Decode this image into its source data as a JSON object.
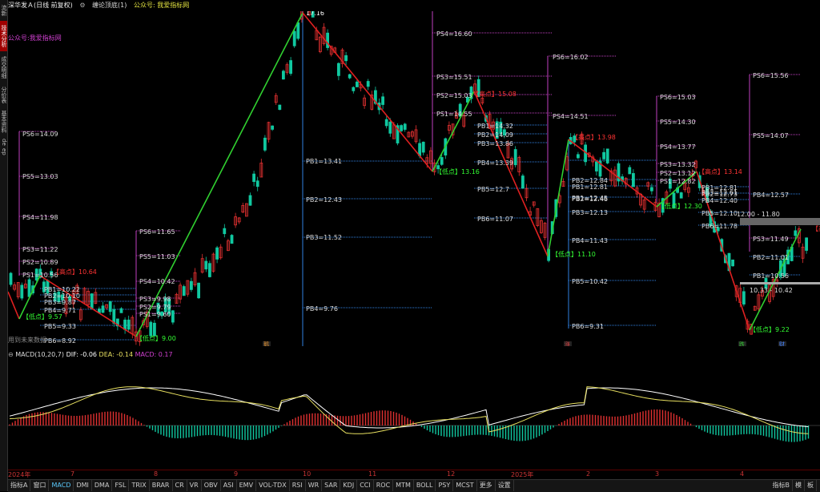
{
  "header": {
    "stock": "深华发Ａ(日线 前复权)",
    "indicator": "缠论顶底(1)",
    "watermark_note": "公众号: 我爱指标网"
  },
  "chart_note": "公众号:我爱指标网",
  "future_note": "用到未来数据",
  "left_rail": [
    "流新",
    "技术分析",
    "成交明细",
    "分价表",
    "基本资料",
    "de",
    "ep"
  ],
  "main_labels": [
    {
      "text": "17.16",
      "color": "#fff"
    },
    {
      "text": "PS4=16.60",
      "color": "#ddd"
    },
    {
      "text": "PS6=16.02",
      "color": "#ddd"
    },
    {
      "text": "PS3=15.51",
      "color": "#ddd"
    },
    {
      "text": "PS2=15.03",
      "color": "#ddd"
    },
    {
      "text": "【高点】15.08",
      "color": "#f33"
    },
    {
      "text": "PS1=14.55",
      "color": "#ddd"
    },
    {
      "text": "PS4=14.51",
      "color": "#ddd"
    },
    {
      "text": "PB1=14.32",
      "color": "#ddd"
    },
    {
      "text": "PB2=14.09",
      "color": "#ddd"
    },
    {
      "text": "PB3=13.86",
      "color": "#ddd"
    },
    {
      "text": "【高点】13.98",
      "color": "#f33"
    },
    {
      "text": "PB1=13.41",
      "color": "#ddd"
    },
    {
      "text": "PB4=13.39",
      "color": "#ddd"
    },
    {
      "text": "【低点】13.16",
      "color": "#3f3"
    },
    {
      "text": "PS6=15.03",
      "color": "#ddd"
    },
    {
      "text": "PS5=14.30",
      "color": "#ddd"
    },
    {
      "text": "PS4=13.77",
      "color": "#ddd"
    },
    {
      "text": "PS3=13.32",
      "color": "#ddd"
    },
    {
      "text": "PS2=13.12",
      "color": "#ddd"
    },
    {
      "text": "【高点】13.14",
      "color": "#f33"
    },
    {
      "text": "PS1=12.82",
      "color": "#ddd"
    },
    {
      "text": "PB2=12.43",
      "color": "#ddd"
    },
    {
      "text": "PB5=12.7",
      "color": "#ddd"
    },
    {
      "text": "PS6=14.09",
      "color": "#ddd"
    },
    {
      "text": "PS5=13.03",
      "color": "#ddd"
    },
    {
      "text": "PS4=11.98",
      "color": "#ddd"
    },
    {
      "text": "PS3=11.22",
      "color": "#ddd"
    },
    {
      "text": "PS2=10.89",
      "color": "#ddd"
    },
    {
      "text": "PS1=10.56",
      "color": "#ddd"
    },
    {
      "text": "【高点】10.64",
      "color": "#f33"
    },
    {
      "text": "PS6=11.65",
      "color": "#ddd"
    },
    {
      "text": "PS5=11.03",
      "color": "#ddd"
    },
    {
      "text": "PS4=10.42",
      "color": "#ddd"
    },
    {
      "text": "PS3=9.98",
      "color": "#ddd"
    },
    {
      "text": "PS2=9.79",
      "color": "#ddd"
    },
    {
      "text": "PS1=9.60",
      "color": "#ddd"
    },
    {
      "text": "【低点】9.00",
      "color": "#3f3"
    },
    {
      "text": "PB1=10.22",
      "color": "#ddd"
    },
    {
      "text": "PB2=10.10",
      "color": "#ddd"
    },
    {
      "text": "PB3=9.87",
      "color": "#ddd"
    },
    {
      "text": "PB4=9.71",
      "color": "#ddd"
    },
    {
      "text": "【低点】9.57",
      "color": "#3f3"
    },
    {
      "text": "PB5=9.33",
      "color": "#ddd"
    },
    {
      "text": "PB6=8.92",
      "color": "#ddd"
    },
    {
      "text": "PB3=11.52",
      "color": "#ddd"
    },
    {
      "text": "PB4=9.76",
      "color": "#ddd"
    },
    {
      "text": "PB6=11.07",
      "color": "#ddd"
    },
    {
      "text": "【低点】11.10",
      "color": "#3f3"
    },
    {
      "text": "PB2=12.84",
      "color": "#ddd"
    },
    {
      "text": "PB1=12.81",
      "color": "#ddd"
    },
    {
      "text": "PB1=12.45",
      "color": "#ddd"
    },
    {
      "text": "PB2=12.46",
      "color": "#ddd"
    },
    {
      "text": "PB3=12.13",
      "color": "#ddd"
    },
    {
      "text": "PB4=11.43",
      "color": "#ddd"
    },
    {
      "text": "PB5=10.42",
      "color": "#ddd"
    },
    {
      "text": "PB6=9.31",
      "color": "#ddd"
    },
    {
      "text": "【低点】12.30",
      "color": "#3f3"
    },
    {
      "text": "PB1=12.81",
      "color": "#ddd"
    },
    {
      "text": "PB2=12.73",
      "color": "#ddd"
    },
    {
      "text": "PB3=12.61",
      "color": "#ddd"
    },
    {
      "text": "PB4=12.40",
      "color": "#ddd"
    },
    {
      "text": "PB5=12.10",
      "color": "#ddd"
    },
    {
      "text": "PB6=11.78",
      "color": "#ddd"
    },
    {
      "text": "12.00 - 11.80",
      "color": "#ddd"
    },
    {
      "text": "PS6=15.56",
      "color": "#ddd"
    },
    {
      "text": "PS5=14.07",
      "color": "#ddd"
    },
    {
      "text": "PB4=12.57",
      "color": "#ddd"
    },
    {
      "text": "PS3=11.49",
      "color": "#ddd"
    },
    {
      "text": "PB2=11.01",
      "color": "#ddd"
    },
    {
      "text": "PB1=10.56",
      "color": "#ddd"
    },
    {
      "text": "10.33 - 10.42",
      "color": "#ddd"
    },
    {
      "text": "【低点】9.22",
      "color": "#3f3"
    },
    {
      "text": "【高",
      "color": "#f33"
    }
  ],
  "event_badges": [
    {
      "text": "鹅",
      "color": "#e09030"
    },
    {
      "text": "涨",
      "color": "#e04040"
    },
    {
      "text": "跌",
      "color": "#30c030"
    },
    {
      "text": "财",
      "color": "#4080ff"
    }
  ],
  "macd": {
    "title": "MACD(10,20,7)",
    "dif_label": "DIF: -0.06",
    "dea_label": "DEA: -0.14",
    "macd_label": "MACD: 0.17"
  },
  "date_axis": [
    "2024年",
    "7",
    "8",
    "9",
    "10",
    "11",
    "12",
    "2025年",
    "2",
    "3",
    "4"
  ],
  "tabs": {
    "left": [
      "指标A",
      "窗口",
      "MACD",
      "DMI",
      "DMA",
      "FSL",
      "TRIX",
      "BRAR",
      "CR",
      "VR",
      "OBV",
      "ASI",
      "EMV",
      "VOL-TDX",
      "RSI",
      "WR",
      "SAR",
      "KDJ",
      "CCI",
      "ROC",
      "MTM",
      "BOLL",
      "PSY",
      "MCST",
      "更多",
      "设置"
    ],
    "active": "MACD",
    "right": [
      "指标B",
      "模",
      "板"
    ]
  },
  "colors": {
    "up": "#e03030",
    "down": "#10c8a0",
    "zigzag_up": "#30d030",
    "zigzag_down": "#e02020",
    "ps_line": "#c040c0",
    "pb_line": "#3080e0",
    "dif": "#ffffff",
    "dea": "#e8e060",
    "macd_text": "#d040d0"
  }
}
